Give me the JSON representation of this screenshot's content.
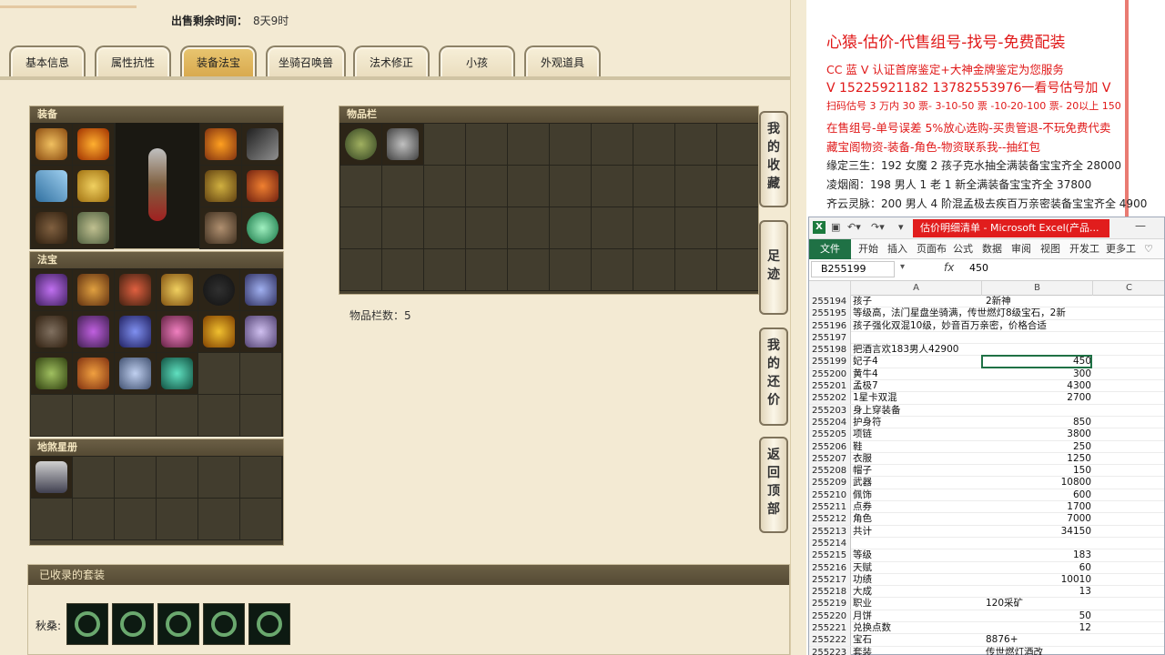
{
  "left": {
    "sell_time_label": "出售剩余时间：",
    "sell_time_value": "8天9时",
    "tabs": [
      "基本信息",
      "属性抗性",
      "装备法宝",
      "坐骑召唤兽",
      "法术修正",
      "小孩",
      "外观道具"
    ],
    "active_tab": 2,
    "panels": {
      "equipment": "装备",
      "fabao": "法宝",
      "dishaxingce": "地煞星册",
      "inventory": "物品栏"
    },
    "inventory_count_label": "物品栏数：5",
    "side_buttons": [
      [
        "我",
        "的",
        "收",
        "藏"
      ],
      [
        "足",
        "迹"
      ],
      [
        "我",
        "的",
        "还",
        "价"
      ],
      [
        "返",
        "回",
        "顶",
        "部"
      ]
    ],
    "suit": {
      "title": "已收录的套装",
      "label": "秋桑:"
    },
    "colors": {
      "panel_bg": "#4a4330",
      "tab_active": "#d8a84c",
      "page_bg": "#f3ead3"
    }
  },
  "ad": {
    "title": "心猿-估价-代售组号-找号-免费配装",
    "lines": [
      "CC 蓝 V 认证首席鉴定+大神金牌鉴定为您服务",
      "V 15225921182      13782553976一看号估号加 V",
      "扫码估号 3 万内 30 票- 3-10-50 票  -10-20-100 票- 20以上 150",
      "在售组号-单号误差 5%放心选购-买贵管退-不玩免费代卖",
      "藏宝阁物资-装备-角色-物资联系我--抽红包",
      "缘定三生：192 女魔 2 孩子克水抽全满装备宝宝齐全 28000",
      "凌烟阁：198 男人 1 老 1 新全满装备宝宝齐全 37800",
      "齐云灵脉：200 男人 4 阶混孟极去疾百万亲密装备宝宝齐全 4900"
    ]
  },
  "excel": {
    "doc_title": "估价明细清单 - Microsoft Excel(产品...",
    "ribbon_tabs": [
      "文件",
      "开始",
      "插入",
      "页面布",
      "公式",
      "数据",
      "审阅",
      "视图",
      "开发工",
      "更多工"
    ],
    "name_box": "B255199",
    "fx": "fx",
    "formula_value": "450",
    "columns": [
      "A",
      "B",
      "C"
    ],
    "rows": [
      [
        "255194",
        "孩子",
        "2新神"
      ],
      [
        "255195",
        "等级高，法门星盘坐骑满，传世燃灯8级宝石，2新",
        ""
      ],
      [
        "255196",
        "孩子强化双混10级，妙音百万亲密，价格合适",
        ""
      ],
      [
        "255197",
        "",
        ""
      ],
      [
        "255198",
        "把酒言欢183男人42900",
        ""
      ],
      [
        "255199",
        "妃子4",
        "450"
      ],
      [
        "255200",
        "黄牛4",
        "300"
      ],
      [
        "255201",
        "孟极7",
        "4300"
      ],
      [
        "255202",
        "1星卡双混",
        "2700"
      ],
      [
        "255203",
        "身上穿装备",
        ""
      ],
      [
        "255204",
        "护身符",
        "850"
      ],
      [
        "255205",
        "项链",
        "3800"
      ],
      [
        "255206",
        "鞋",
        "250"
      ],
      [
        "255207",
        "衣服",
        "1250"
      ],
      [
        "255208",
        "帽子",
        "150"
      ],
      [
        "255209",
        "武器",
        "10800"
      ],
      [
        "255210",
        "佩饰",
        "600"
      ],
      [
        "255211",
        "点券",
        "1700"
      ],
      [
        "255212",
        "角色",
        "7000"
      ],
      [
        "255213",
        "共计",
        "34150"
      ],
      [
        "255214",
        "",
        ""
      ],
      [
        "255215",
        "等级",
        "183"
      ],
      [
        "255216",
        "天赋",
        "60"
      ],
      [
        "255217",
        "功绩",
        "10010"
      ],
      [
        "255218",
        "大成",
        "13"
      ],
      [
        "255219",
        "职业",
        "120采矿"
      ],
      [
        "255220",
        "月饼",
        "50"
      ],
      [
        "255221",
        "兑换点数",
        "12"
      ],
      [
        "255222",
        "宝石",
        "8876+"
      ],
      [
        "255223",
        "套装",
        "传世燃灯酒改"
      ]
    ]
  }
}
